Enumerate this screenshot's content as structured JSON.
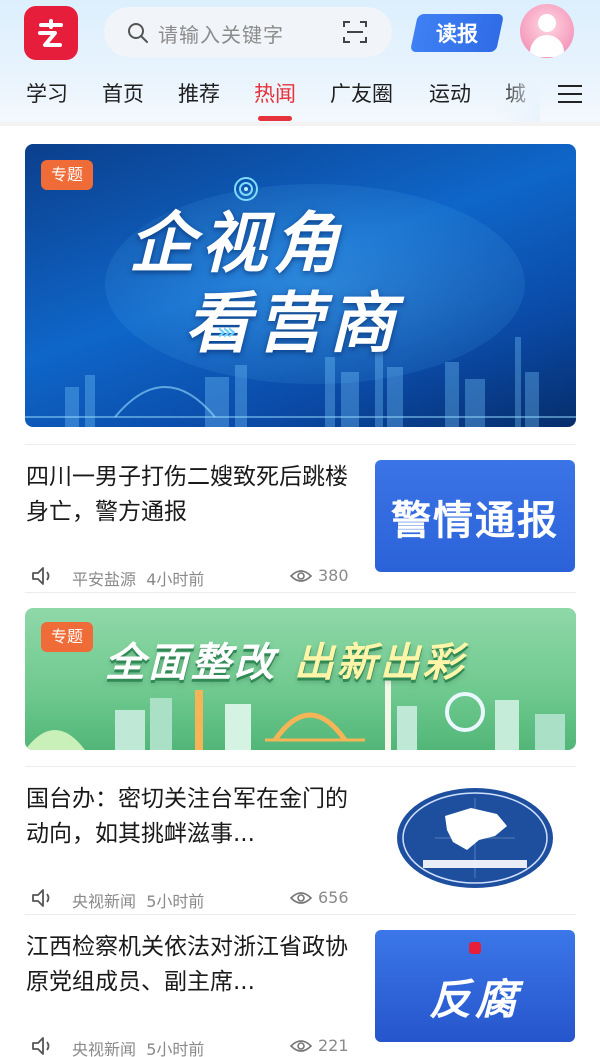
{
  "header": {
    "search_placeholder": "请输入关键字",
    "read_button": "读报"
  },
  "tabs": [
    "学习",
    "首页",
    "推荐",
    "热闻",
    "广友圈",
    "运动",
    "城"
  ],
  "active_tab": "热闻",
  "feed": {
    "banner_top": {
      "badge": "专题",
      "line1": "企视角",
      "line2": "看营商"
    },
    "news": [
      {
        "title": "四川一男子打伤二嫂致死后跳楼身亡，警方通报",
        "source": "平安盐源",
        "time": "4小时前",
        "views": "380",
        "thumb_text": "警情通报"
      },
      {
        "title": "国台办：密切关注台军在金门的动向，如其挑衅滋事...",
        "source": "央视新闻",
        "time": "5小时前",
        "views": "656",
        "thumb_text": ""
      },
      {
        "title": "江西检察机关依法对浙江省政协原党组成员、副主席...",
        "source": "央视新闻",
        "time": "5小时前",
        "views": "221",
        "thumb_text": "反腐"
      }
    ],
    "banner_mid": {
      "badge": "专题",
      "headline_a": "全面整改",
      "headline_b": "出新出彩"
    }
  },
  "colors": {
    "accent_red": "#e5323b",
    "badge_orange": "#ef6b38",
    "read_blue": "#3f80f4"
  }
}
